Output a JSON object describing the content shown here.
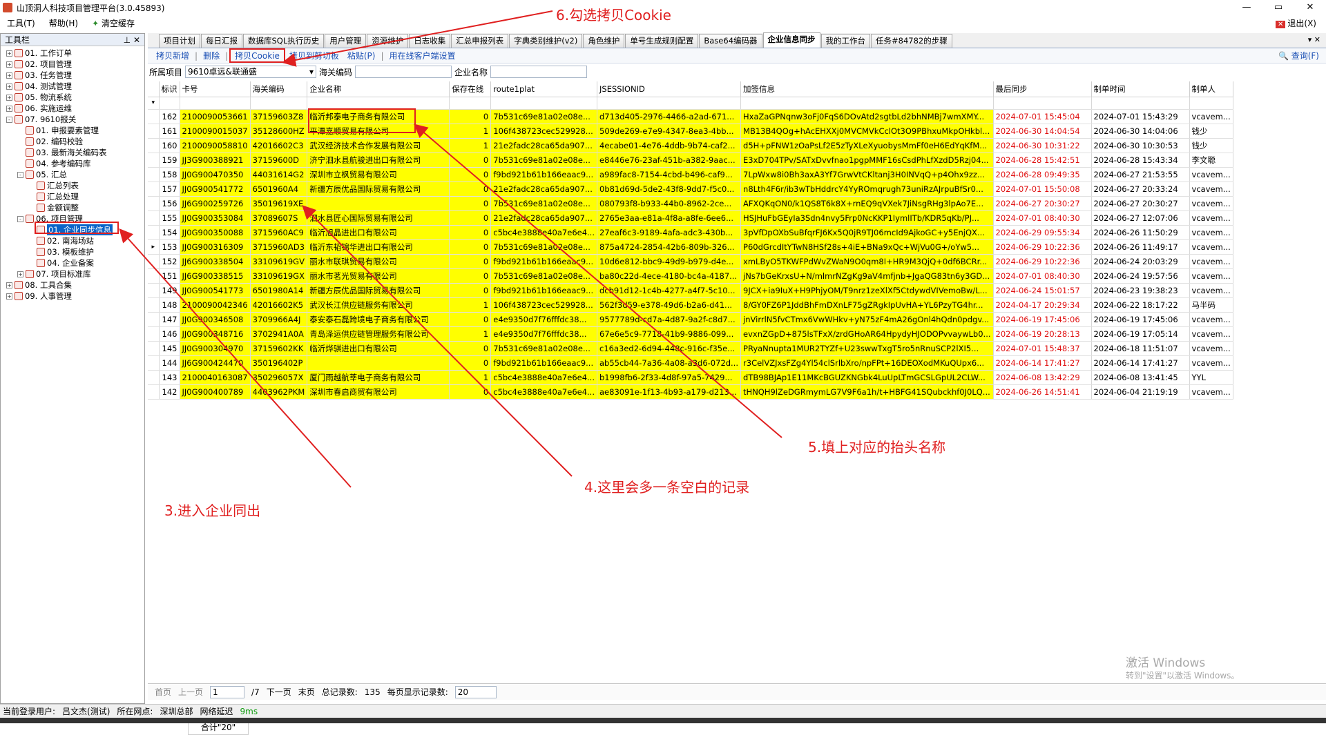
{
  "window": {
    "title": "山顶洞人科技项目管理平台(3.0.45893)",
    "min": "—",
    "max": "▭",
    "close": "✕"
  },
  "menu": {
    "tool": "工具(T)",
    "help": "帮助(H)",
    "clear_cache": "清空缓存",
    "exit": "退出(X)"
  },
  "left_panel": {
    "title": "工具栏",
    "pin": "⊥ ✕",
    "tree": [
      {
        "label": "01. 工作订单",
        "level": 0,
        "exp": "+"
      },
      {
        "label": "02. 项目管理",
        "level": 0,
        "exp": "+"
      },
      {
        "label": "03. 任务管理",
        "level": 0,
        "exp": "+"
      },
      {
        "label": "04. 测试管理",
        "level": 0,
        "exp": "+"
      },
      {
        "label": "05. 物流系统",
        "level": 0,
        "exp": "+"
      },
      {
        "label": "06. 实施运维",
        "level": 0,
        "exp": "+"
      },
      {
        "label": "07. 9610报关",
        "level": 0,
        "exp": "-"
      },
      {
        "label": "01. 申报要素管理",
        "level": 1,
        "exp": ""
      },
      {
        "label": "02. 编码校验",
        "level": 1,
        "exp": ""
      },
      {
        "label": "03. 最新海关编码表",
        "level": 1,
        "exp": ""
      },
      {
        "label": "04. 参考编码库",
        "level": 1,
        "exp": ""
      },
      {
        "label": "05. 汇总",
        "level": 1,
        "exp": "-"
      },
      {
        "label": "汇总列表",
        "level": 2,
        "exp": ""
      },
      {
        "label": "汇总处理",
        "level": 2,
        "exp": ""
      },
      {
        "label": "金额调整",
        "level": 2,
        "exp": ""
      },
      {
        "label": "06. 项目管理",
        "level": 1,
        "exp": "-"
      },
      {
        "label": "01. 企业同步信息",
        "level": 2,
        "exp": "",
        "selected": true
      },
      {
        "label": "02. 南海场站",
        "level": 2,
        "exp": ""
      },
      {
        "label": "03. 模板维护",
        "level": 2,
        "exp": ""
      },
      {
        "label": "04. 企业备案",
        "level": 2,
        "exp": ""
      },
      {
        "label": "07. 项目标准库",
        "level": 1,
        "exp": "+"
      },
      {
        "label": "08. 工具合集",
        "level": 0,
        "exp": "+"
      },
      {
        "label": "09. 人事管理",
        "level": 0,
        "exp": "+"
      }
    ]
  },
  "tabs": [
    "项目计划",
    "每日汇报",
    "数据库SQL执行历史",
    "用户管理",
    "资源维护",
    "日志收集",
    "汇总申报列表",
    "字典类别维护(v2)",
    "角色维护",
    "单号生成规则配置",
    "Base64编码器",
    "企业信息同步",
    "我的工作台",
    "任务#84782的步骤"
  ],
  "active_tab": "企业信息同步",
  "tab_controls": "▾ ✕",
  "toolbar": {
    "new": "拷贝新增",
    "delete": "删除",
    "copy_cookie": "拷贝Cookie",
    "copy_clip": "拷贝到剪切板",
    "paste": "粘贴(P)",
    "online": "用在线客户端设置",
    "query": "查询(F)"
  },
  "filter": {
    "project_label": "所属项目",
    "project_value": "9610卓远&联通盛",
    "customs_label": "海关编码",
    "customs_value": "",
    "company_label": "企业名称",
    "company_value": ""
  },
  "grid": {
    "columns": [
      "标识",
      "卡号",
      "海关编码",
      "企业名称",
      "保存在线",
      "route1plat",
      "JSESSIONID",
      "加签信息",
      "最后同步",
      "制单时间",
      "制单人"
    ],
    "rows": [
      [
        "162",
        "2100090053661",
        "37159603Z8",
        "临沂邦泰电子商务有限公司",
        "0",
        "7b531c69e81a02e08e...",
        "d713d405-2976-4466-a2ad-671...",
        "HxaZaGPNqnw3oFj0FqS6DOvAtd2sgtbLd2bhNMBj7wmXMY...",
        "2024-07-01 15:45:04",
        "2024-07-01 15:43:29",
        "vcavem..."
      ],
      [
        "161",
        "2100090015037",
        "35128600HZ",
        "平潭嘉顺贸易有限公司",
        "1",
        "106f438723cec529928...",
        "509de269-e7e9-4347-8ea3-4bb...",
        "MB13B4QOg+hAcEHXXj0MVCMVkCclOt3O9PBhxuMkpOHkbl...",
        "2024-06-30 14:04:54",
        "2024-06-30 14:04:06",
        "钱少"
      ],
      [
        "160",
        "2100090058810",
        "42016602C3",
        "武汉经济技术合作发展有限公司",
        "1",
        "21e2fadc28ca65da907...",
        "4ecabe01-4e76-4ddb-9b74-caf2...",
        "d5H+pFNW1zOaPsLf2E5zTyXLeXyuobysMmFf0eH6EdYqKfM...",
        "2024-06-30 10:31:22",
        "2024-06-30 10:30:53",
        "钱少"
      ],
      [
        "159",
        "JJ3G900388921",
        "37159600D",
        "济宁泗水县航骏进出口有限公司",
        "0",
        "7b531c69e81a02e08e...",
        "e8446e76-23af-451b-a382-9aac...",
        "E3xD704TPv/SATxDvvfnao1pgpMMF16sCsdPhLfXzdD5Rzj04...",
        "2024-06-28 15:42:51",
        "2024-06-28 15:43:34",
        "李文聪"
      ],
      [
        "158",
        "JJ0G900470350",
        "44031614G2",
        "深圳市立枫贸易有限公司",
        "0",
        "f9bd921b61b166eaac9...",
        "a989fac8-7154-4cbd-b496-caf9...",
        "7LpWxw8i0Bh3axA3Yf7GrwVtCKltanj3H0INVqQ+p4Ohx9zz...",
        "2024-06-28 09:49:35",
        "2024-06-27 21:53:55",
        "vcavem..."
      ],
      [
        "157",
        "JJ0G900541772",
        "6501960A4",
        "新疆方辰优品国际贸易有限公司",
        "0",
        "21e2fadc28ca65da907...",
        "0b81d69d-5de2-43f8-9dd7-f5c0...",
        "n8Lth4F6r/ib3wTbHddrcY4YyROmqrugh73uniRzAJrpuBfSr0...",
        "2024-07-01 15:50:08",
        "2024-06-27 20:33:24",
        "vcavem..."
      ],
      [
        "156",
        "JJ6G900259726",
        "35019619XE",
        "",
        "0",
        "7b531c69e81a02e08e...",
        "080793f8-b933-44b0-8962-2ce...",
        "AFXQKqON0/k1QS8T6k8X+rnEQ9qVXek7JiNsgRHg3lpAo7E...",
        "2024-06-27 20:30:27",
        "2024-06-27 20:30:27",
        "vcavem..."
      ],
      [
        "155",
        "JJ0G900353084",
        "37089607S",
        "泗水县匠心国际贸易有限公司",
        "0",
        "21e2fadc28ca65da907...",
        "2765e3aa-e81a-4f8a-a8fe-6ee6...",
        "HSJHuFbGEyIa3Sdn4nvy5Frp0NcKKP1IymlITb/KDR5qKb/PJ...",
        "2024-07-01 08:40:30",
        "2024-06-27 12:07:06",
        "vcavem..."
      ],
      [
        "154",
        "JJ0G900350088",
        "3715960AC9",
        "临沂旭晶进出口有限公司",
        "0",
        "c5bc4e3888e40a7e6e4...",
        "27eaf6c3-9189-4afa-adc3-430b...",
        "3pVfDpOXbSuBfqrFJ6Kx5Q0jR9TJ06mcId9AjkoGC+y5EnjQX...",
        "2024-06-29 09:55:34",
        "2024-06-26 11:50:29",
        "vcavem..."
      ],
      [
        "153",
        "JJ0G900316309",
        "3715960AD3",
        "临沂东韬锦华进出口有限公司",
        "0",
        "7b531c69e81a02e08e...",
        "875a4724-2854-42b6-809b-326...",
        "P60dGrcdItYTwN8HSf28s+4iE+BNa9xQc+WjVu0G+/oYw5...",
        "2024-06-29 10:22:36",
        "2024-06-26 11:49:17",
        "vcavem..."
      ],
      [
        "152",
        "JJ6G900338504",
        "33109619GV",
        "丽水市联琪贸易有限公司",
        "0",
        "f9bd921b61b166eaac9...",
        "10d6e812-bbc9-49d9-b979-d4e...",
        "xmLByO5TKWFPdWvZWaN9O0qm8I+HR9M3QjQ+0df6BCRr...",
        "2024-06-29 10:22:36",
        "2024-06-24 20:03:29",
        "vcavem..."
      ],
      [
        "151",
        "JJ6G900338515",
        "33109619GX",
        "丽水市茗光贸易有限公司",
        "0",
        "7b531c69e81a02e08e...",
        "ba80c22d-4ece-4180-bc4a-4187...",
        "jNs7bGeKrxsU+N/mlmrNZgKg9aV4mfjnb+JgaQG83tn6y3GD...",
        "2024-07-01 08:40:30",
        "2024-06-24 19:57:56",
        "vcavem..."
      ],
      [
        "149",
        "JJ0G900541773",
        "6501980A14",
        "新疆方辰优品国际贸易有限公司",
        "0",
        "f9bd921b61b166eaac9...",
        "dcb91d12-1c4b-4277-a4f7-5c10...",
        "9JCX+ia9IuX+H9PhjyOM/T9nrz1zeXlXf5CtdywdVIVemoBw/L...",
        "2024-06-24 15:01:57",
        "2024-06-23 19:38:23",
        "vcavem..."
      ],
      [
        "148",
        "2100090042346",
        "42016602K5",
        "武汉长江供应链服务有限公司",
        "1",
        "106f438723cec529928...",
        "562f3d59-e378-49d6-b2a6-d41...",
        "8/GY0FZ6P1JddBhFmDXnLF75gZRgkIpUvHA+YL6PzyTG4hr...",
        "2024-04-17 20:29:34",
        "2024-06-22 18:17:22",
        "马半码"
      ],
      [
        "147",
        "JJ0G900346508",
        "3709966A4J",
        "泰安泰石磊跨境电子商务有限公司",
        "0",
        "e4e9350d7f76fffdc38...",
        "9577789d-cd7a-4d87-9a2f-c8d7...",
        "jnVirrlN5fvCTmx6VwWHkv+yN75zF4mA26gOnl4hQdn0pdgv...",
        "2024-06-19 17:45:06",
        "2024-06-19 17:45:06",
        "vcavem..."
      ],
      [
        "146",
        "JJ0G900348716",
        "3702941A0A",
        "青岛泽运供应链管理服务有限公司",
        "1",
        "e4e9350d7f76fffdc38...",
        "67e6e5c9-7718-41b9-9886-099...",
        "evxnZGpD+875lsTFxX/zrdGHoAR64HpydyHJODOPvvaywLb0...",
        "2024-06-19 20:28:13",
        "2024-06-19 17:05:14",
        "vcavem..."
      ],
      [
        "145",
        "JJ0G900304970",
        "37159602KK",
        "临沂烨骐进出口有限公司",
        "0",
        "7b531c69e81a02e08e...",
        "c16a3ed2-6d94-448c-916c-f35e...",
        "PRyaNnupta1MUR2TYZf+U23swwTxgT5ro5nRnuSCP2lXI5...",
        "2024-07-01 15:48:37",
        "2024-06-18 11:51:07",
        "vcavem..."
      ],
      [
        "144",
        "JJ6G900424470",
        "350196402P",
        "",
        "0",
        "f9bd921b61b166eaac9...",
        "ab55cb44-7a36-4a08-a3d6-072d...",
        "r3CelVZJxsFZg4Yl54clSrlbXro/npFPt+16DEOXodMKuQUpx6...",
        "2024-06-14 17:41:27",
        "2024-06-14 17:41:27",
        "vcavem..."
      ],
      [
        "143",
        "2100040163087",
        "350296057X",
        "厦门雨越航莘电子商务有限公司",
        "1",
        "c5bc4e3888e40a7e6e4...",
        "b1998fb6-2f33-4d8f-97a5-7429...",
        "dTB98BJAp1E11MKcBGUZKNGbk4LuUpLTmGCSLGpUL2CLW...",
        "2024-06-08 13:42:29",
        "2024-06-08 13:41:45",
        "YYL"
      ],
      [
        "142",
        "JJ0G900400789",
        "4403962PKM",
        "深圳市春启商贸有限公司",
        "0",
        "c5bc4e3888e40a7e6e4...",
        "ae83091e-1f13-4b93-a179-d213...",
        "tHNQH9lZeDGRmymLG7V9F6a1h/t+HBFG41SQubckhf0J0LQ...",
        "2024-06-26 14:51:41",
        "2024-06-04 21:19:19",
        "vcavem..."
      ]
    ],
    "sum_label": "合计\"20\""
  },
  "pager": {
    "first": "首页",
    "prev": "上一页",
    "page": "1",
    "total_pages": "/7",
    "next": "下一页",
    "last": "末页",
    "total_label": "总记录数:",
    "total": "135",
    "per_page_label": "每页显示记录数:",
    "per_page": "20"
  },
  "status": {
    "user_label": "当前登录用户:",
    "user": "吕文杰(测试)",
    "site_label": "所在网点:",
    "site": "深圳总部",
    "latency_label": "网络延迟",
    "latency": "9ms"
  },
  "watermark": {
    "line1": "激活 Windows",
    "line2": "转到\"设置\"以激活 Windows。"
  },
  "annotations": {
    "step6": "6.勾选拷贝Cookie",
    "step5": "5.填上对应的抬头名称",
    "step4": "4.这里会多一条空白的记录",
    "step3": "3.进入企业同出"
  },
  "colors": {
    "highlight": "#ffff00",
    "annotation": "#e02020",
    "accent": "#1a4fb4",
    "selected": "#0a64c8"
  }
}
